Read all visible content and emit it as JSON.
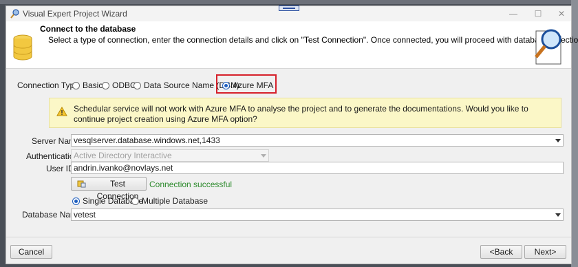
{
  "window": {
    "title": "Visual Expert Project Wizard"
  },
  "header": {
    "title": "Connect to the database",
    "description": "Select a type of connection, enter the connection details and click on \"Test Connection\". Once connected, you will proceed with database selection."
  },
  "connection_type": {
    "label": "Connection Type",
    "options": [
      "Basic",
      "ODBC",
      "Data Source Name (DSN)",
      "Azure MFA"
    ],
    "selected": "Azure MFA"
  },
  "warning": {
    "text": "Schedular service will not work with Azure MFA to analyse the project and to generate the documentations. Would you like to continue project creation using Azure MFA option?"
  },
  "server": {
    "label": "Server Name",
    "value": "vesqlserver.database.windows.net,1433"
  },
  "authentication": {
    "label": "Authentication",
    "value": "Active Directory Interactive"
  },
  "user": {
    "label": "User ID",
    "value": "andrin.ivanko@novlays.net"
  },
  "test": {
    "button_label": "Test Connection",
    "status": "Connection successful"
  },
  "database_mode": {
    "options": [
      "Single Database",
      "Multiple Database"
    ],
    "selected": "Single Database"
  },
  "database": {
    "label": "Database Name",
    "value": "vetest"
  },
  "footer": {
    "cancel": "Cancel",
    "back": "<Back",
    "next": "Next>"
  },
  "colors": {
    "accent": "#1f5fbf",
    "highlight": "#d6202a",
    "success": "#2e8b2e",
    "warning_bg": "#fbf7c7"
  },
  "icons": [
    "app-icon",
    "database-icon",
    "magnifier-icon",
    "warning-icon",
    "connection-icon"
  ]
}
